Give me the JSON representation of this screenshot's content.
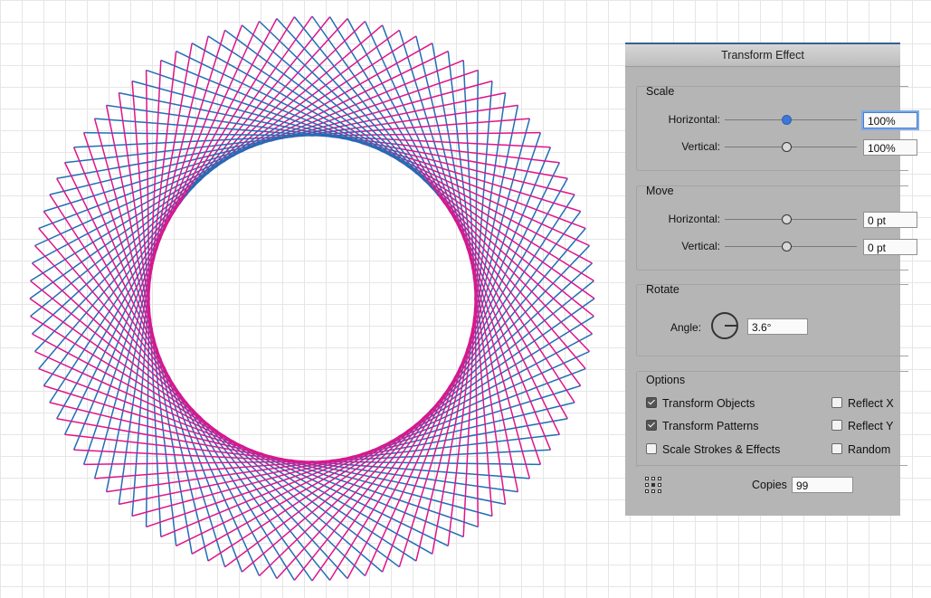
{
  "artwork": {
    "colors": {
      "pink": "#e0148c",
      "blue": "#1e6fb5"
    }
  },
  "panel": {
    "title": "Transform Effect",
    "scale": {
      "title": "Scale",
      "horizontal_label": "Horizontal:",
      "horizontal_value": "100%",
      "vertical_label": "Vertical:",
      "vertical_value": "100%"
    },
    "move": {
      "title": "Move",
      "horizontal_label": "Horizontal:",
      "horizontal_value": "0 pt",
      "vertical_label": "Vertical:",
      "vertical_value": "0 pt"
    },
    "rotate": {
      "title": "Rotate",
      "angle_label": "Angle:",
      "angle_value": "3.6°"
    },
    "options": {
      "title": "Options",
      "transform_objects": {
        "label": "Transform Objects",
        "checked": true
      },
      "transform_patterns": {
        "label": "Transform Patterns",
        "checked": true
      },
      "scale_strokes": {
        "label": "Scale Strokes & Effects",
        "checked": false
      },
      "reflect_x": {
        "label": "Reflect X",
        "checked": false
      },
      "reflect_y": {
        "label": "Reflect Y",
        "checked": false
      },
      "random": {
        "label": "Random",
        "checked": false
      }
    },
    "copies_label": "Copies",
    "copies_value": "99",
    "accent_color": "#3e78d6"
  }
}
